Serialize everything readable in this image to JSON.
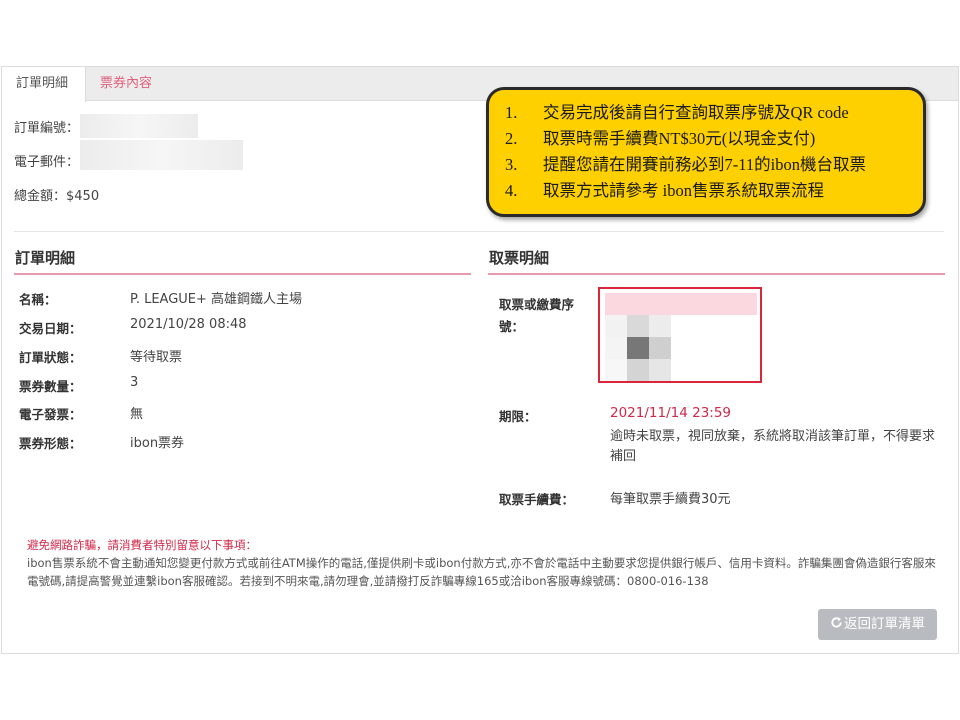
{
  "tabs": [
    {
      "label": "訂單明細",
      "active": true
    },
    {
      "label": "票券內容",
      "active": false
    }
  ],
  "order_info": {
    "order_no_label": "訂單編號：",
    "email_label": "電子郵件：",
    "total_label": "總金額：$450"
  },
  "callout": {
    "items": [
      {
        "num": "1.",
        "text": "交易完成後請自行查詢取票序號及QR code"
      },
      {
        "num": "2.",
        "text": "取票時需手續費NT$30元(以現金支付)"
      },
      {
        "num": "3.",
        "text": "提醒您請在開賽前務必到7-11的ibon機台取票"
      },
      {
        "num": "4.",
        "text": "取票方式請參考 ibon售票系統取票流程"
      }
    ]
  },
  "order_detail": {
    "title": "訂單明細",
    "rows": [
      {
        "label": "名稱：",
        "value": "P. LEAGUE+  高雄鋼鐵人主場"
      },
      {
        "label": "交易日期：",
        "value": "2021/10/28  08:48"
      },
      {
        "label": "訂單狀態：",
        "value": "等待取票"
      },
      {
        "label": "票券數量：",
        "value": "3"
      },
      {
        "label": "電子發票：",
        "value": "無"
      },
      {
        "label": "票券形態：",
        "value": "ibon票券"
      }
    ]
  },
  "pickup_detail": {
    "title": "取票明細",
    "code_label_1": "取票或繳費序",
    "code_label_2": "號：",
    "deadline_label": "期限：",
    "deadline_value": "2021/11/14  23:59",
    "deadline_note": "逾時未取票，視同放棄，系統將取消該筆訂單，不得要求補回",
    "fee_label": "取票手續費：",
    "fee_value": "每筆取票手續費30元"
  },
  "warning": {
    "title": "避免網路詐騙，請消費者特別留意以下事項：",
    "text": "ibon售票系統不會主動通知您變更付款方式或前往ATM操作的電話,僅提供刷卡或ibon付款方式,亦不會於電話中主動要求您提供銀行帳戶、信用卡資料。詐騙集團會偽造銀行客服來電號碼,請提高警覺並連繫ibon客服確認。若接到不明來電,請勿理會,並請撥打反詐騙專線165或洽ibon客服專線號碼：0800-016-138"
  },
  "back_button": {
    "icon": "refresh-icon",
    "label": "返回訂單清單"
  },
  "colors": {
    "accent": "#e0607e",
    "red": "#d0294a",
    "callout": "#fed000"
  }
}
